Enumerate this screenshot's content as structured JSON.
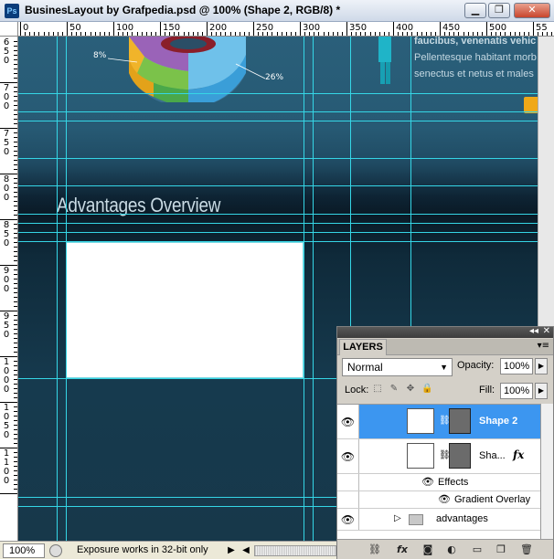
{
  "window": {
    "app_icon": "Ps",
    "title": "BusinesLayout by Grafpedia.psd @ 100% (Shape 2, RGB/8) *",
    "buttons": [
      "minimize",
      "restore",
      "close"
    ]
  },
  "ruler_top": {
    "labels": [
      "0",
      "50",
      "100",
      "150",
      "200",
      "250",
      "300",
      "350",
      "400",
      "450",
      "500",
      "55"
    ]
  },
  "ruler_left": {
    "labels": [
      "650",
      "700",
      "750",
      "800",
      "850",
      "900",
      "950",
      "1000",
      "1050",
      "1100"
    ]
  },
  "canvas": {
    "heading": "Advantages Overview",
    "pie_labels": [
      "8%",
      "26%"
    ],
    "body_lines": [
      "faucibus, venenatis vehic",
      "Pellentesque habitant morb",
      "senectus et netus et males"
    ]
  },
  "statusbar": {
    "zoom": "100%",
    "message": "Exposure works in 32-bit only"
  },
  "layers_panel": {
    "tab": "LAYERS",
    "blend_mode": "Normal",
    "opacity_label": "Opacity:",
    "opacity_value": "100%",
    "lock_label": "Lock:",
    "fill_label": "Fill:",
    "fill_value": "100%",
    "layers": [
      {
        "name": "Shape 2",
        "selected": true
      },
      {
        "name": "Sha...",
        "selected": false
      }
    ],
    "effects_label": "Effects",
    "effect_item": "Gradient Overlay",
    "group_name": "advantages"
  },
  "colors": {
    "guide": "#35d6e6",
    "selection": "#3c96f0",
    "accent_orange": "#f0a818"
  }
}
